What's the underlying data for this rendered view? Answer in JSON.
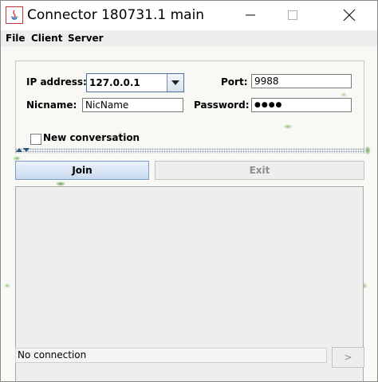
{
  "window": {
    "title": "Connector 180731.1 main",
    "icon": "java-icon"
  },
  "menu": {
    "items": [
      {
        "label": "File"
      },
      {
        "label": "Client"
      },
      {
        "label": "Server"
      }
    ]
  },
  "form": {
    "ip_label": "IP address:",
    "ip_value": "127.0.0.1",
    "port_label": "Port:",
    "port_value": "9988",
    "nickname_label": "Nicname:",
    "nickname_value": "NicName",
    "password_label": "Password:",
    "password_value": "●●●●",
    "new_conversation_label": "New conversation",
    "new_conversation_checked": false
  },
  "buttons": {
    "join_label": "Join",
    "exit_label": "Exit",
    "send_label": ">"
  },
  "status": {
    "text": "No connection"
  },
  "colors": {
    "join_border": "#7a9cc6",
    "combo_border": "#4b6ea3",
    "disabled_text": "#8e8e8e"
  }
}
